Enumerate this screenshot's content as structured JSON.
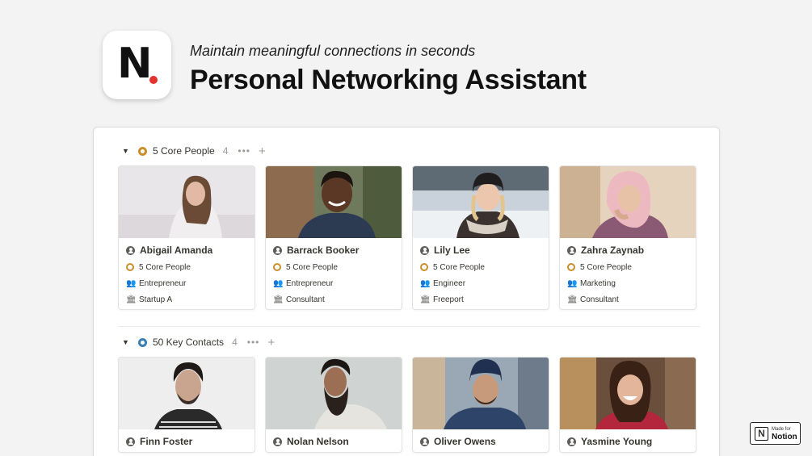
{
  "header": {
    "subtitle": "Maintain meaningful connections in seconds",
    "title": "Personal Networking Assistant",
    "logo_letter": "N",
    "logo_dot_color": "#e5302e"
  },
  "groups": [
    {
      "name": "5 Core People",
      "count": "4",
      "ring_color": "#c98f2a",
      "cards": [
        {
          "name": "Abigail Amanda",
          "category": "5 Core People",
          "role": "Entrepreneur",
          "company": "Startup A"
        },
        {
          "name": "Barrack Booker",
          "category": "5 Core People",
          "role": "Entrepreneur",
          "company": "Consultant"
        },
        {
          "name": "Lily Lee",
          "category": "5 Core People",
          "role": "Engineer",
          "company": "Freeport"
        },
        {
          "name": "Zahra Zaynab",
          "category": "5 Core People",
          "role": "Marketing",
          "company": "Consultant"
        }
      ]
    },
    {
      "name": "50 Key Contacts",
      "count": "4",
      "ring_color": "#3b7fb6",
      "cards": [
        {
          "name": "Finn Foster"
        },
        {
          "name": "Nolan Nelson"
        },
        {
          "name": "Oliver Owens"
        },
        {
          "name": "Yasmine Young"
        }
      ]
    }
  ],
  "icons": {
    "collapse": "triangle-down-icon",
    "more": "ellipsis-icon",
    "add": "plus-icon",
    "person": "person-icon",
    "role": "people-icon",
    "company": "building-icon"
  },
  "badge": {
    "made_for": "Made for",
    "notion": "Notion",
    "letter": "N"
  }
}
